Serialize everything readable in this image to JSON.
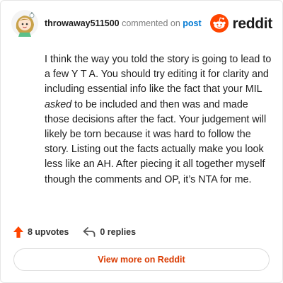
{
  "comment": {
    "username": "throwaway511500",
    "action_text": "commented on",
    "target_text": "post",
    "body_before_emphasis": "I think the way you told the story is going to lead to a few Y T A. You should try editing it for clarity and including essential info like the fact that your MIL ",
    "body_emphasis": "asked",
    "body_after_emphasis": " to be included and then was and made those decisions after the fact. Your judgement will likely be torn because it was hard to follow the story. Listing out the facts actually make you look less like an AH. After piecing it all together myself though the comments and OP, it’s NTA for me."
  },
  "brand": {
    "wordmark": "reddit",
    "brand_color": "#ff4500",
    "link_color": "#0079d3",
    "button_text_color": "#d93a00"
  },
  "footer": {
    "upvotes_label": "8 upvotes",
    "replies_label": "0 replies"
  },
  "cta": {
    "view_more_label": "View more on Reddit"
  },
  "icons": {
    "avatar": "snoo-avatar-icon",
    "logo": "reddit-logo-icon",
    "upvote": "upvote-arrow-icon",
    "reply": "reply-arrow-icon"
  }
}
